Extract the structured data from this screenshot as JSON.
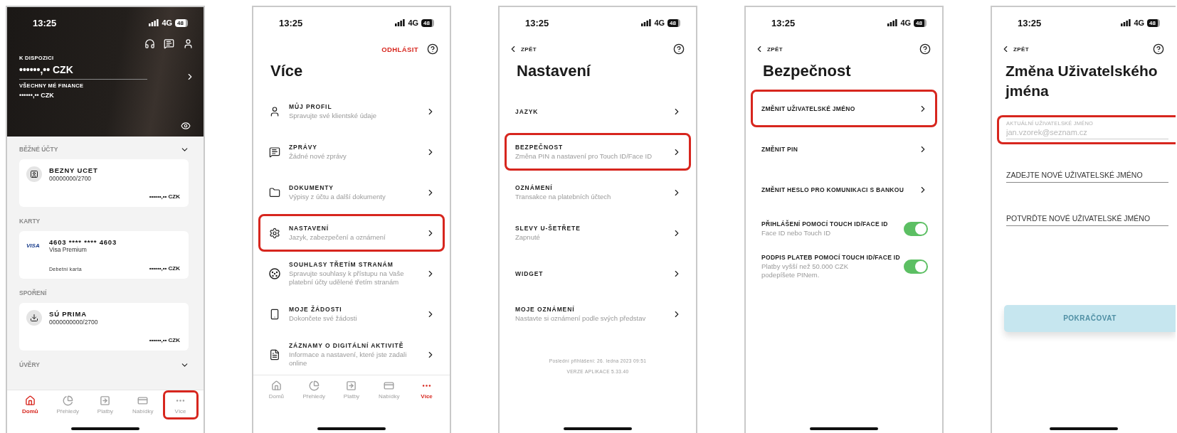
{
  "home_screen": {
    "status_bar": {
      "time": "13:25",
      "network": "4G",
      "battery": "48"
    },
    "balance": {
      "label": "K DISPOZICI",
      "amount": "••••••,•• CZK",
      "total_label": "VŠECHNY MÉ FINANCE",
      "total_amount": "••••••,•• CZK"
    },
    "sections": [
      {
        "title": "BĚŽNÉ ÚČTY",
        "collapsible": true,
        "cards": [
          {
            "kind": "account",
            "name": "BEZNY UCET",
            "number": "00000000/2700",
            "balance": "••••••,•• CZK"
          }
        ]
      },
      {
        "title": "KARTY",
        "collapsible": false,
        "cards": [
          {
            "kind": "card",
            "brand": "VISA",
            "name": "4603 **** **** 4603",
            "number": "Visa Premium",
            "note": "Debetní karta",
            "balance": "••••••,•• CZK"
          }
        ]
      },
      {
        "title": "SPOŘENÍ",
        "collapsible": false,
        "cards": [
          {
            "kind": "savings",
            "name": "SÚ PRIMA",
            "number": "0000000000/2700",
            "balance": "••••••,•• CZK"
          }
        ]
      },
      {
        "title": "ÚVĚRY",
        "collapsible": true
      }
    ],
    "tabs": [
      {
        "kind": "home",
        "label": "Domů",
        "selected": true,
        "highlighted": false
      },
      {
        "kind": "overview",
        "label": "Přehledy",
        "selected": false,
        "highlighted": false
      },
      {
        "kind": "payments",
        "label": "Platby",
        "selected": false,
        "highlighted": false
      },
      {
        "kind": "offers",
        "label": "Nabídky",
        "selected": false,
        "highlighted": false
      },
      {
        "kind": "more",
        "label": "Více",
        "selected": false,
        "highlighted": true
      }
    ]
  },
  "more_screen": {
    "status_bar": {
      "time": "13:25",
      "network": "4G",
      "battery": "48"
    },
    "logout": "ODHLÁSIT",
    "title": "Více",
    "items": [
      {
        "kind": "profile",
        "title": "MŮJ PROFIL",
        "subtitle": "Spravujte své klientské údaje",
        "highlighted": false
      },
      {
        "kind": "messages",
        "title": "ZPRÁVY",
        "subtitle": "Žádné nové zprávy",
        "highlighted": false
      },
      {
        "kind": "documents",
        "title": "DOKUMENTY",
        "subtitle": "Výpisy z účtu a další dokumenty",
        "highlighted": false
      },
      {
        "kind": "settings",
        "title": "NASTAVENÍ",
        "subtitle": "Jazyk, zabezpečení a oznámení",
        "highlighted": true
      },
      {
        "kind": "consents",
        "title": "SOUHLASY TŘETÍM STRANÁM",
        "subtitle": "Spravujte souhlasy k přístupu na Vaše platební účty udělené třetím stranám",
        "highlighted": false
      },
      {
        "kind": "requests",
        "title": "MOJE ŽÁDOSTI",
        "subtitle": "Dokončete své žádosti",
        "highlighted": false
      },
      {
        "kind": "activity",
        "title": "ZÁZNAMY O DIGITÁLNÍ AKTIVITĚ",
        "subtitle": "Informace a nastavení, které jste zadali online",
        "highlighted": false
      }
    ],
    "tabs": [
      {
        "kind": "home",
        "label": "Domů",
        "selected": false,
        "highlighted": false
      },
      {
        "kind": "overview",
        "label": "Přehledy",
        "selected": false,
        "highlighted": false
      },
      {
        "kind": "payments",
        "label": "Platby",
        "selected": false,
        "highlighted": false
      },
      {
        "kind": "offers",
        "label": "Nabídky",
        "selected": false,
        "highlighted": false
      },
      {
        "kind": "more",
        "label": "Více",
        "selected": true,
        "highlighted": false
      }
    ]
  },
  "settings_screen": {
    "status_bar": {
      "time": "13:25",
      "network": "4G",
      "battery": "48"
    },
    "back": "ZPĚT",
    "title": "Nastavení",
    "items": [
      {
        "title": "JAZYK",
        "highlighted": false
      },
      {
        "title": "BEZPEČNOST",
        "subtitle": "Změna PIN a nastavení pro Touch ID/Face ID",
        "highlighted": true
      },
      {
        "title": "OZNÁMENÍ",
        "subtitle": "Transakce na platebních účtech",
        "highlighted": false
      },
      {
        "title": "SLEVY U-ŠETŘETE",
        "subtitle": "Zapnuté",
        "highlighted": false
      },
      {
        "title": "WIDGET",
        "highlighted": false
      },
      {
        "title": "MOJE OZNÁMENÍ",
        "subtitle": "Nastavte si oznámení podle svých představ",
        "highlighted": false
      }
    ],
    "last_login": "Poslední přihlášení: 26. ledna 2023 09:51",
    "version": "VERZE APLIKACE 5.33.40"
  },
  "security_screen": {
    "status_bar": {
      "time": "13:25",
      "network": "4G",
      "battery": "48"
    },
    "back": "ZPĚT",
    "title": "Bezpečnost",
    "items": [
      {
        "kind": "link",
        "title": "ZMĚNIT UŽIVATELSKÉ JMÉNO",
        "highlighted": true
      },
      {
        "kind": "link",
        "title": "ZMĚNIT PIN",
        "highlighted": false
      },
      {
        "kind": "link",
        "title": "ZMĚNIT HESLO PRO KOMUNIKACI S BANKOU",
        "highlighted": false
      },
      {
        "kind": "toggle",
        "title": "PŘIHLÁŠENÍ POMOCÍ TOUCH ID/FACE ID",
        "subtitle": "Face ID nebo Touch ID",
        "on": true,
        "highlighted": false
      },
      {
        "kind": "toggle",
        "title": "PODPIS PLATEB POMOCÍ TOUCH ID/FACE ID",
        "subtitle": "Platby vyšší než 50.000 CZK podepíšete PINem.",
        "on": true,
        "highlighted": false
      }
    ]
  },
  "username_screen": {
    "status_bar": {
      "time": "13:25",
      "network": "4G",
      "battery": "48"
    },
    "back": "ZPĚT",
    "title": "Změna Uživatelského jména",
    "fields": [
      {
        "label": "AKTUÁLNÍ UŽIVATELSKÉ JMÉNO",
        "value": "jan.vzorek@seznam.cz",
        "disabled": true,
        "highlighted": true
      },
      {
        "placeholder": "ZADEJTE NOVÉ UŽIVATELSKÉ JMÉNO",
        "disabled": false,
        "highlighted": false
      },
      {
        "placeholder": "POTVRĎTE NOVÉ UŽIVATELSKÉ JMÉNO",
        "disabled": false,
        "highlighted": false
      }
    ],
    "continue_button": {
      "label": "POKRAČOVAT",
      "disabled": true
    }
  }
}
